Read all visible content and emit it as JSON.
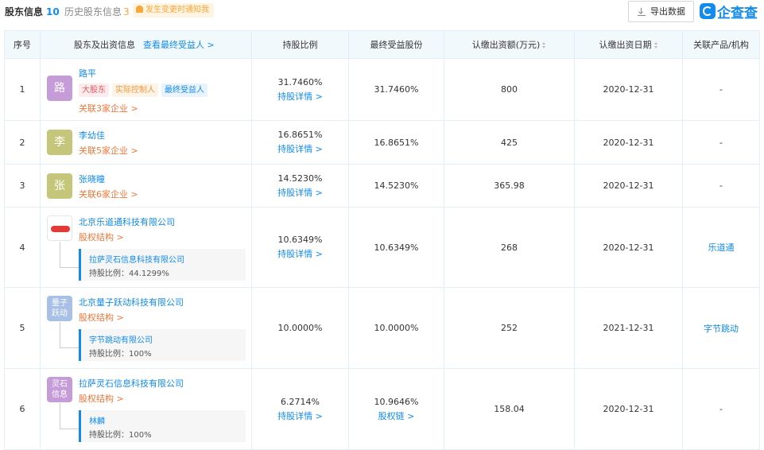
{
  "tabs": {
    "current_label": "股东信息",
    "current_count": "10",
    "history_label": "历史股东信息",
    "history_count": "3",
    "notify_label": "发生变更时通知我"
  },
  "toolbar": {
    "export_label": "导出数据",
    "logo_text": "企查查"
  },
  "table": {
    "headers": {
      "index": "序号",
      "holder": "股东及出资信息",
      "beneficiary_link": "查看最终受益人 >",
      "ratio": "持股比例",
      "final_share": "最终受益股份",
      "subscribed_amount": "认缴出资额(万元)",
      "subscribed_date": "认缴出资日期",
      "related": "关联产品/机构"
    },
    "detail_link": "持股详情 >",
    "rows": [
      {
        "index": "1",
        "avatar_text": "路",
        "avatar_color": "#c59bd8",
        "name": "路平",
        "related_companies": "关联3家企业 >",
        "tags": [
          "大股东",
          "实际控制人",
          "最终受益人"
        ],
        "ratio": "31.7460%",
        "final_share": "31.7460%",
        "amount": "800",
        "date": "2020-12-31",
        "related": "-"
      },
      {
        "index": "2",
        "avatar_text": "李",
        "avatar_color": "#c5c679",
        "name": "李幼佳",
        "related_companies": "关联5家企业 >",
        "ratio": "16.8651%",
        "final_share": "16.8651%",
        "amount": "425",
        "date": "2020-12-31",
        "related": "-"
      },
      {
        "index": "3",
        "avatar_text": "张",
        "avatar_color": "#c5c679",
        "name": "张晓瞳",
        "related_companies": "关联6家企业 >",
        "ratio": "14.5230%",
        "final_share": "14.5230%",
        "amount": "365.98",
        "date": "2020-12-31",
        "related": "-"
      },
      {
        "index": "4",
        "avatar_text": "",
        "name": "北京乐道通科技有限公司",
        "structure_link": "股权结构 >",
        "sub_name": "拉萨灵石信息科技有限公司",
        "sub_ratio": "持股比例：44.1299%",
        "ratio": "10.6349%",
        "final_share": "10.6349%",
        "amount": "268",
        "date": "2020-12-31",
        "related": "乐道通"
      },
      {
        "index": "5",
        "avatar_text_1": "量子",
        "avatar_text_2": "跃动",
        "avatar_color": "#a9c0e6",
        "name": "北京量子跃动科技有限公司",
        "structure_link": "股权结构 >",
        "sub_name": "字节跳动有限公司",
        "sub_ratio": "持股比例：100%",
        "ratio": "10.0000%",
        "final_share": "10.0000%",
        "amount": "252",
        "date": "2021-12-31",
        "related": "字节跳动"
      },
      {
        "index": "6",
        "avatar_text_1": "灵石",
        "avatar_text_2": "信息",
        "avatar_color": "#c59bd8",
        "name": "拉萨灵石信息科技有限公司",
        "structure_link": "股权结构 >",
        "sub_name": "林麟",
        "sub_ratio": "持股比例：100%",
        "ratio": "6.2714%",
        "final_share": "10.9646%",
        "final_share_link": "股权链 >",
        "amount": "158.04",
        "date": "2020-12-31",
        "related": "-"
      }
    ]
  },
  "colors": {
    "accent": "#128bed",
    "orange": "#f2763a",
    "tag_red_bg": "#fdecee",
    "tag_red_fg": "#e95b5b",
    "tag_orange_bg": "#fdf3e6",
    "tag_orange_fg": "#f2963a",
    "tag_blue_bg": "#e8f3fd",
    "tag_blue_fg": "#128bed"
  }
}
